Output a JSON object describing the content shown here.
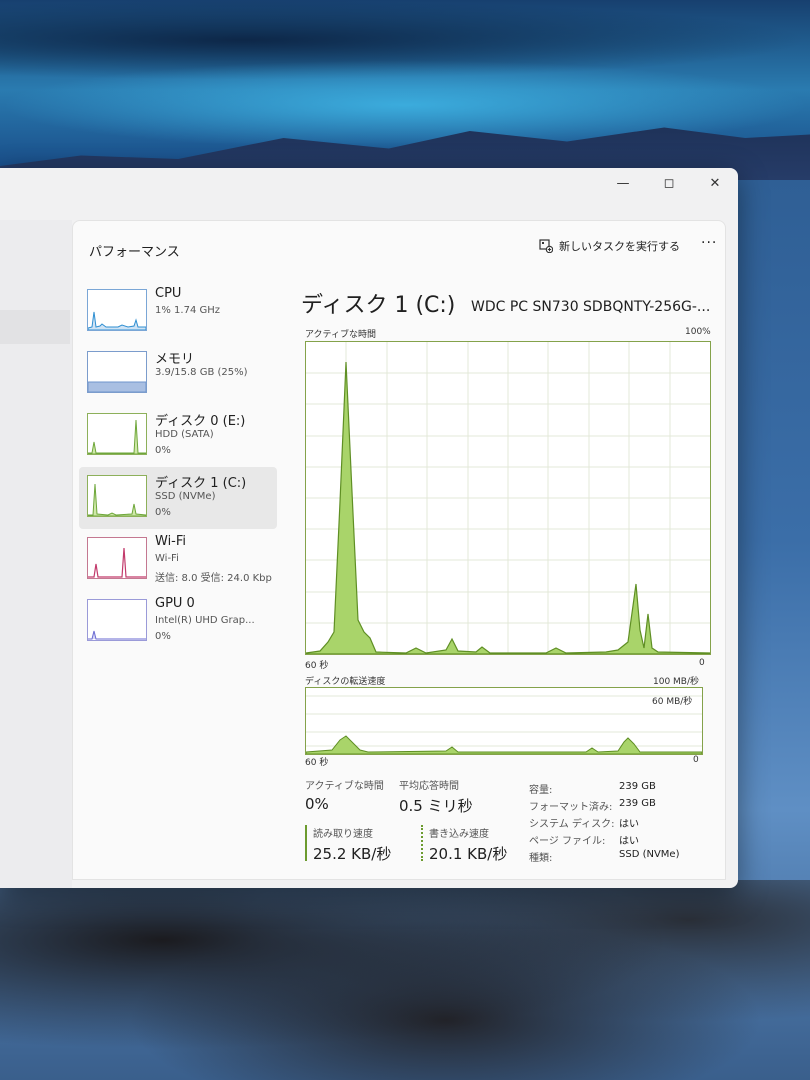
{
  "window": {
    "minimize_icon": "minimize-icon",
    "maximize_icon": "maximize-icon",
    "close_icon": "close-icon"
  },
  "header": {
    "title": "パフォーマンス",
    "run_task": "新しいタスクを実行する",
    "more": "···"
  },
  "sidebar": {
    "items": [
      {
        "name": "CPU",
        "line1": "1%  1.74 GHz",
        "line2": "",
        "color": "#2f8fd1"
      },
      {
        "name": "メモリ",
        "line1": "3.9/15.8 GB (25%)",
        "line2": "",
        "color": "#6f95cc"
      },
      {
        "name": "ディスク 0 (E:)",
        "line1": "HDD (SATA)",
        "line2": "0%",
        "color": "#6ea63a"
      },
      {
        "name": "ディスク 1 (C:)",
        "line1": "SSD (NVMe)",
        "line2": "0%",
        "color": "#6ea63a"
      },
      {
        "name": "Wi-Fi",
        "line1": "Wi-Fi",
        "line2": "送信: 8.0 受信: 24.0 Kbp",
        "color": "#c23a6b"
      },
      {
        "name": "GPU 0",
        "line1": "Intel(R) UHD Grap...",
        "line2": "0%",
        "color": "#6a6ad1"
      }
    ]
  },
  "detail": {
    "title": "ディスク 1 (C:)",
    "model": "WDC PC SN730 SDBQNTY-256G-...",
    "graph1": {
      "label": "アクティブな時間",
      "max": "100%",
      "left": "60 秒",
      "right": "0"
    },
    "graph2": {
      "label": "ディスクの転送速度",
      "max": "100 MB/秒",
      "mid": "60 MB/秒",
      "left": "60 秒",
      "right": "0"
    },
    "stats": {
      "active_label": "アクティブな時間",
      "active_value": "0%",
      "response_label": "平均応答時間",
      "response_value": "0.5 ミリ秒",
      "read_label": "読み取り速度",
      "read_value": "25.2 KB/秒",
      "write_label": "書き込み速度",
      "write_value": "20.1 KB/秒"
    },
    "props": [
      {
        "key": "容量:",
        "value": "239 GB"
      },
      {
        "key": "フォーマット済み:",
        "value": "239 GB"
      },
      {
        "key": "システム ディスク:",
        "value": "はい"
      },
      {
        "key": "ページ ファイル:",
        "value": "はい"
      },
      {
        "key": "種類:",
        "value": "SSD (NVMe)"
      }
    ]
  },
  "colors": {
    "disk_fill": "#a9d46a",
    "disk_line": "#5f8f24"
  }
}
